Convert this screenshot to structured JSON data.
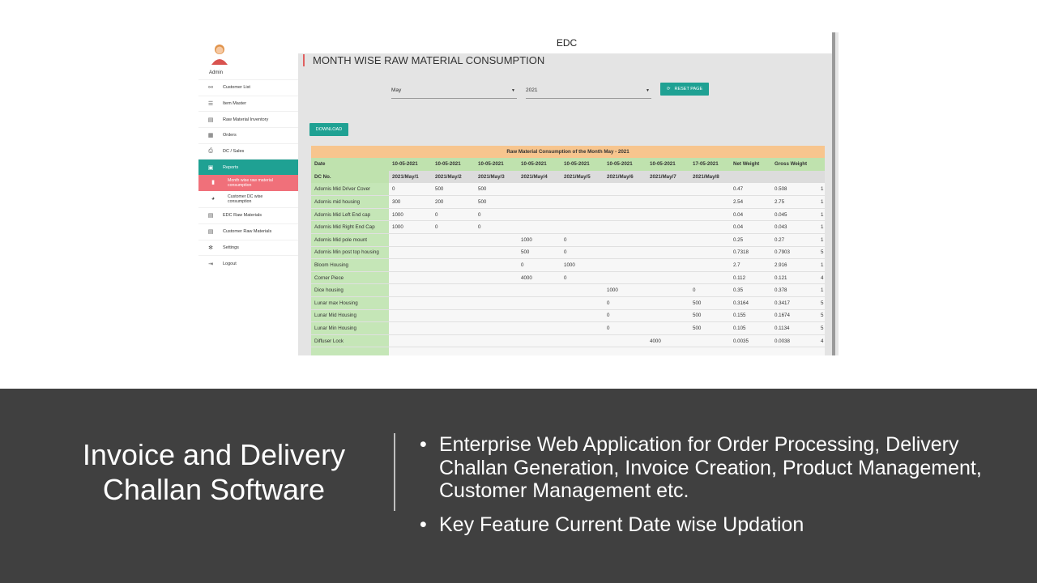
{
  "app": {
    "title": "EDC",
    "user": "Admin"
  },
  "sidebar": {
    "items": [
      {
        "label": "Customer List",
        "icon": "users-icon"
      },
      {
        "label": "Item Master",
        "icon": "stack-icon"
      },
      {
        "label": "Raw Material Inventory",
        "icon": "archive-icon"
      },
      {
        "label": "Orders",
        "icon": "list-icon"
      },
      {
        "label": "DC / Sales",
        "icon": "printer-icon"
      },
      {
        "label": "Reports",
        "icon": "chart-icon",
        "active": true
      },
      {
        "label": "Month wise raw material consumption",
        "icon": "bar-chart-icon",
        "active": true,
        "sub": true
      },
      {
        "label": "Customer DC wise consumption",
        "icon": "pie-chart-icon",
        "sub": true
      },
      {
        "label": "EDC Raw Materials",
        "icon": "archive-icon"
      },
      {
        "label": "Customer Raw Materials",
        "icon": "archive-icon"
      },
      {
        "label": "Settings",
        "icon": "gear-icon"
      },
      {
        "label": "Logout",
        "icon": "logout-icon"
      }
    ]
  },
  "page": {
    "title": "MONTH WISE RAW MATERIAL CONSUMPTION"
  },
  "filters": {
    "month": "May",
    "year": "2021",
    "reset_label": "RESET PAGE",
    "download_label": "DOWNLOAD"
  },
  "table": {
    "caption": "Raw Material Consumption of the Month May - 2021",
    "date_header": "Date",
    "dc_header": "DC No.",
    "dates": [
      "10-05-2021",
      "10-05-2021",
      "10-05-2021",
      "10-05-2021",
      "10-05-2021",
      "10-05-2021",
      "10-05-2021",
      "17-05-2021"
    ],
    "dc_numbers": [
      "2021/May/1",
      "2021/May/2",
      "2021/May/3",
      "2021/May/4",
      "2021/May/5",
      "2021/May/6",
      "2021/May/7",
      "2021/May/8"
    ],
    "net_weight_header": "Net Weight",
    "gross_weight_header": "Gross Weight",
    "rows": [
      {
        "name": "Adornis Mid Driver Cover",
        "vals": [
          "0",
          "500",
          "500",
          "",
          "",
          "",
          "",
          ""
        ],
        "net": "0.47",
        "gross": "0.508",
        "extra": "1"
      },
      {
        "name": "Adornis mid housing",
        "vals": [
          "300",
          "200",
          "500",
          "",
          "",
          "",
          "",
          ""
        ],
        "net": "2.54",
        "gross": "2.75",
        "extra": "1"
      },
      {
        "name": "Adornis Mid Left End cap",
        "vals": [
          "1000",
          "0",
          "0",
          "",
          "",
          "",
          "",
          ""
        ],
        "net": "0.04",
        "gross": "0.045",
        "extra": "1"
      },
      {
        "name": "Adornis Mid Right End Cap",
        "vals": [
          "1000",
          "0",
          "0",
          "",
          "",
          "",
          "",
          ""
        ],
        "net": "0.04",
        "gross": "0.043",
        "extra": "1"
      },
      {
        "name": "Adornis Mid pole mount",
        "vals": [
          "",
          "",
          "",
          "1000",
          "0",
          "",
          "",
          ""
        ],
        "net": "0.25",
        "gross": "0.27",
        "extra": "1"
      },
      {
        "name": "Adornis Min post top housing",
        "vals": [
          "",
          "",
          "",
          "500",
          "0",
          "",
          "",
          ""
        ],
        "net": "0.7318",
        "gross": "0.7903",
        "extra": "5"
      },
      {
        "name": "Bloom Housing",
        "vals": [
          "",
          "",
          "",
          "0",
          "1000",
          "",
          "",
          ""
        ],
        "net": "2.7",
        "gross": "2.916",
        "extra": "1"
      },
      {
        "name": "Corner Piece",
        "vals": [
          "",
          "",
          "",
          "4000",
          "0",
          "",
          "",
          ""
        ],
        "net": "0.112",
        "gross": "0.121",
        "extra": "4"
      },
      {
        "name": "Dice housing",
        "vals": [
          "",
          "",
          "",
          "",
          "",
          "1000",
          "",
          "0"
        ],
        "net": "0.35",
        "gross": "0.378",
        "extra": "1"
      },
      {
        "name": "Lunar max Housing",
        "vals": [
          "",
          "",
          "",
          "",
          "",
          "0",
          "",
          "500"
        ],
        "net": "0.3164",
        "gross": "0.3417",
        "extra": "5"
      },
      {
        "name": "Lunar Mid Housing",
        "vals": [
          "",
          "",
          "",
          "",
          "",
          "0",
          "",
          "500"
        ],
        "net": "0.155",
        "gross": "0.1674",
        "extra": "5"
      },
      {
        "name": "Lunar Min Housing",
        "vals": [
          "",
          "",
          "",
          "",
          "",
          "0",
          "",
          "500"
        ],
        "net": "0.105",
        "gross": "0.1134",
        "extra": "5"
      },
      {
        "name": "Diffuser Lock",
        "vals": [
          "",
          "",
          "",
          "",
          "",
          "",
          "4000",
          ""
        ],
        "net": "0.0035",
        "gross": "0.0038",
        "extra": "4"
      },
      {
        "name": "",
        "vals": [
          "",
          "",
          "",
          "",
          "",
          "",
          "",
          ""
        ],
        "net": "",
        "gross": "",
        "extra": ""
      }
    ]
  },
  "slide": {
    "title": "Invoice and Delivery Challan Software",
    "bullets": [
      "Enterprise Web Application for Order Processing, Delivery Challan Generation, Invoice Creation, Product Management, Customer Management etc.",
      "Key Feature Current Date wise Updation"
    ],
    "colors": {
      "teal": "#1fa193",
      "highlight": "#f0707a",
      "banner": "#404040"
    }
  }
}
